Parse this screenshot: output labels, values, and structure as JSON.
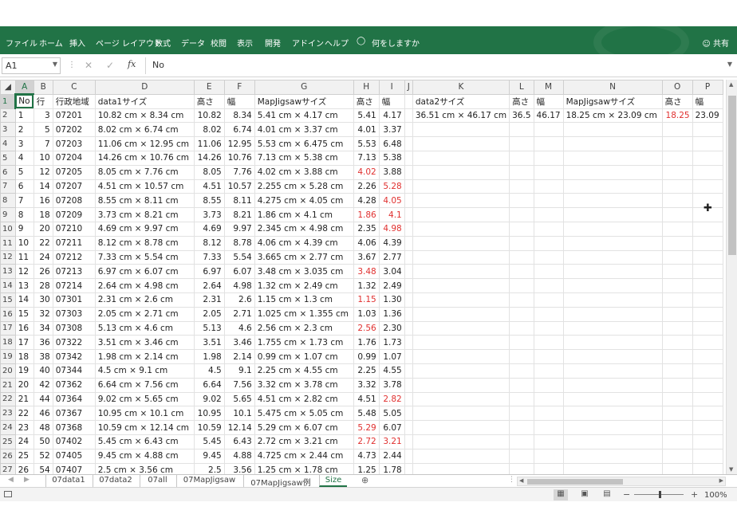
{
  "ribbon": {
    "tabs": [
      "ファイル",
      "ホーム",
      "挿入",
      "ページ レイアウト",
      "数式",
      "データ",
      "校閲",
      "表示",
      "開発",
      "アドイン",
      "ヘルプ"
    ],
    "tell_me": "何をしますか",
    "share": "共有",
    "color": "#217346"
  },
  "formula_bar": {
    "name_box": "A1",
    "fx_label": "fx",
    "value": "No"
  },
  "sheet": {
    "columns": [
      "A",
      "B",
      "C",
      "D",
      "E",
      "F",
      "G",
      "H",
      "I",
      "J",
      "K",
      "L",
      "M",
      "N",
      "O",
      "P"
    ],
    "selected_cell": "A1",
    "header_row": [
      "No",
      "行",
      "行政地域",
      "data1サイズ",
      "高さ",
      "幅",
      "MapJigsawサイズ",
      "高さ",
      "幅",
      "",
      "data2サイズ",
      "高さ",
      "幅",
      "MapJigsawサイズ",
      "高さ",
      "幅"
    ],
    "row2_extra": {
      "K": "36.51 cm × 46.17 cm",
      "L": "36.5",
      "M": "46.17",
      "N": "18.25 cm × 23.09 cm",
      "O": "18.25",
      "P": "23.09"
    },
    "rows": [
      {
        "n": "2",
        "a": "1",
        "b": "3",
        "c": "07201",
        "d": "10.82 cm × 8.34 cm",
        "e": "10.82",
        "f": "8.34",
        "g": "5.41 cm × 4.17 cm",
        "h": "5.41",
        "i": "4.17",
        "hr": false,
        "ir": false
      },
      {
        "n": "3",
        "a": "2",
        "b": "5",
        "c": "07202",
        "d": "8.02 cm × 6.74 cm",
        "e": "8.02",
        "f": "6.74",
        "g": "4.01 cm × 3.37 cm",
        "h": "4.01",
        "i": "3.37",
        "hr": false,
        "ir": false
      },
      {
        "n": "4",
        "a": "3",
        "b": "7",
        "c": "07203",
        "d": "11.06 cm × 12.95 cm",
        "e": "11.06",
        "f": "12.95",
        "g": "5.53 cm × 6.475 cm",
        "h": "5.53",
        "i": "6.48",
        "hr": false,
        "ir": false
      },
      {
        "n": "5",
        "a": "4",
        "b": "10",
        "c": "07204",
        "d": "14.26 cm × 10.76 cm",
        "e": "14.26",
        "f": "10.76",
        "g": "7.13 cm × 5.38 cm",
        "h": "7.13",
        "i": "5.38",
        "hr": false,
        "ir": false
      },
      {
        "n": "6",
        "a": "5",
        "b": "12",
        "c": "07205",
        "d": "8.05 cm × 7.76 cm",
        "e": "8.05",
        "f": "7.76",
        "g": "4.02 cm × 3.88 cm",
        "h": "4.02",
        "i": "3.88",
        "hr": true,
        "ir": false
      },
      {
        "n": "7",
        "a": "6",
        "b": "14",
        "c": "07207",
        "d": "4.51 cm × 10.57 cm",
        "e": "4.51",
        "f": "10.57",
        "g": "2.255 cm × 5.28 cm",
        "h": "2.26",
        "i": "5.28",
        "hr": false,
        "ir": true
      },
      {
        "n": "8",
        "a": "7",
        "b": "16",
        "c": "07208",
        "d": "8.55 cm × 8.11 cm",
        "e": "8.55",
        "f": "8.11",
        "g": "4.275 cm × 4.05 cm",
        "h": "4.28",
        "i": "4.05",
        "hr": false,
        "ir": true
      },
      {
        "n": "9",
        "a": "8",
        "b": "18",
        "c": "07209",
        "d": "3.73 cm × 8.21 cm",
        "e": "3.73",
        "f": "8.21",
        "g": "1.86 cm × 4.1 cm",
        "h": "1.86",
        "i": "4.1",
        "hr": true,
        "ir": true
      },
      {
        "n": "10",
        "a": "9",
        "b": "20",
        "c": "07210",
        "d": "4.69 cm × 9.97 cm",
        "e": "4.69",
        "f": "9.97",
        "g": "2.345 cm × 4.98 cm",
        "h": "2.35",
        "i": "4.98",
        "hr": false,
        "ir": true
      },
      {
        "n": "11",
        "a": "10",
        "b": "22",
        "c": "07211",
        "d": "8.12 cm × 8.78 cm",
        "e": "8.12",
        "f": "8.78",
        "g": "4.06 cm × 4.39 cm",
        "h": "4.06",
        "i": "4.39",
        "hr": false,
        "ir": false
      },
      {
        "n": "12",
        "a": "11",
        "b": "24",
        "c": "07212",
        "d": "7.33 cm × 5.54 cm",
        "e": "7.33",
        "f": "5.54",
        "g": "3.665 cm × 2.77 cm",
        "h": "3.67",
        "i": "2.77",
        "hr": false,
        "ir": false
      },
      {
        "n": "13",
        "a": "12",
        "b": "26",
        "c": "07213",
        "d": "6.97 cm × 6.07 cm",
        "e": "6.97",
        "f": "6.07",
        "g": "3.48 cm × 3.035 cm",
        "h": "3.48",
        "i": "3.04",
        "hr": true,
        "ir": false
      },
      {
        "n": "14",
        "a": "13",
        "b": "28",
        "c": "07214",
        "d": "2.64 cm × 4.98 cm",
        "e": "2.64",
        "f": "4.98",
        "g": "1.32 cm × 2.49 cm",
        "h": "1.32",
        "i": "2.49",
        "hr": false,
        "ir": false
      },
      {
        "n": "15",
        "a": "14",
        "b": "30",
        "c": "07301",
        "d": "2.31 cm × 2.6 cm",
        "e": "2.31",
        "f": "2.6",
        "g": "1.15 cm × 1.3 cm",
        "h": "1.15",
        "i": "1.30",
        "hr": true,
        "ir": false
      },
      {
        "n": "16",
        "a": "15",
        "b": "32",
        "c": "07303",
        "d": "2.05 cm × 2.71 cm",
        "e": "2.05",
        "f": "2.71",
        "g": "1.025 cm × 1.355 cm",
        "h": "1.03",
        "i": "1.36",
        "hr": false,
        "ir": false
      },
      {
        "n": "17",
        "a": "16",
        "b": "34",
        "c": "07308",
        "d": "5.13 cm × 4.6 cm",
        "e": "5.13",
        "f": "4.6",
        "g": "2.56 cm × 2.3 cm",
        "h": "2.56",
        "i": "2.30",
        "hr": true,
        "ir": false
      },
      {
        "n": "18",
        "a": "17",
        "b": "36",
        "c": "07322",
        "d": "3.51 cm × 3.46 cm",
        "e": "3.51",
        "f": "3.46",
        "g": "1.755 cm × 1.73 cm",
        "h": "1.76",
        "i": "1.73",
        "hr": false,
        "ir": false
      },
      {
        "n": "19",
        "a": "18",
        "b": "38",
        "c": "07342",
        "d": "1.98 cm × 2.14 cm",
        "e": "1.98",
        "f": "2.14",
        "g": "0.99 cm × 1.07 cm",
        "h": "0.99",
        "i": "1.07",
        "hr": false,
        "ir": false
      },
      {
        "n": "20",
        "a": "19",
        "b": "40",
        "c": "07344",
        "d": "4.5 cm × 9.1 cm",
        "e": "4.5",
        "f": "9.1",
        "g": "2.25 cm × 4.55 cm",
        "h": "2.25",
        "i": "4.55",
        "hr": false,
        "ir": false
      },
      {
        "n": "21",
        "a": "20",
        "b": "42",
        "c": "07362",
        "d": "6.64 cm × 7.56 cm",
        "e": "6.64",
        "f": "7.56",
        "g": "3.32 cm × 3.78 cm",
        "h": "3.32",
        "i": "3.78",
        "hr": false,
        "ir": false
      },
      {
        "n": "22",
        "a": "21",
        "b": "44",
        "c": "07364",
        "d": "9.02 cm × 5.65 cm",
        "e": "9.02",
        "f": "5.65",
        "g": "4.51 cm × 2.82 cm",
        "h": "4.51",
        "i": "2.82",
        "hr": false,
        "ir": true
      },
      {
        "n": "23",
        "a": "22",
        "b": "46",
        "c": "07367",
        "d": "10.95 cm × 10.1 cm",
        "e": "10.95",
        "f": "10.1",
        "g": "5.475 cm × 5.05 cm",
        "h": "5.48",
        "i": "5.05",
        "hr": false,
        "ir": false
      },
      {
        "n": "24",
        "a": "23",
        "b": "48",
        "c": "07368",
        "d": "10.59 cm × 12.14 cm",
        "e": "10.59",
        "f": "12.14",
        "g": "5.29 cm × 6.07 cm",
        "h": "5.29",
        "i": "6.07",
        "hr": true,
        "ir": false
      },
      {
        "n": "25",
        "a": "24",
        "b": "50",
        "c": "07402",
        "d": "5.45 cm × 6.43 cm",
        "e": "5.45",
        "f": "6.43",
        "g": "2.72 cm × 3.21 cm",
        "h": "2.72",
        "i": "3.21",
        "hr": true,
        "ir": true
      },
      {
        "n": "26",
        "a": "25",
        "b": "52",
        "c": "07405",
        "d": "9.45 cm × 4.88 cm",
        "e": "9.45",
        "f": "4.88",
        "g": "4.725 cm × 2.44 cm",
        "h": "4.73",
        "i": "2.44",
        "hr": false,
        "ir": false
      },
      {
        "n": "27",
        "a": "26",
        "b": "54",
        "c": "07407",
        "d": "2.5 cm × 3.56 cm",
        "e": "2.5",
        "f": "3.56",
        "g": "1.25 cm × 1.78 cm",
        "h": "1.25",
        "i": "1.78",
        "hr": false,
        "ir": false
      }
    ]
  },
  "sheet_tabs": [
    "07data1",
    "07data2",
    "07all",
    "07MapJigsaw",
    "07MapJigsaw例",
    "Size"
  ],
  "active_tab": "Size",
  "status": {
    "zoom": "100%"
  },
  "colors": {
    "accent": "#217346",
    "red_value": "#e0302f"
  }
}
